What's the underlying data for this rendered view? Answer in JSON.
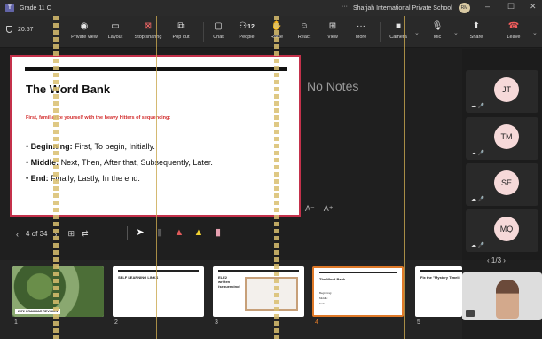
{
  "window": {
    "title": "Grade 11 C",
    "org": "Sharjah International Private School",
    "more": "···",
    "avatar_initials": "RM"
  },
  "toolbar": {
    "timer": "20:57",
    "people_count": "12",
    "buttons": {
      "private_view": "Private view",
      "layout": "Layout",
      "stop_sharing": "Stop sharing",
      "pop_out": "Pop out",
      "chat": "Chat",
      "people": "People",
      "raise": "Raise",
      "react": "React",
      "view": "View",
      "more": "More",
      "camera": "Camera",
      "mic": "Mic",
      "share": "Share",
      "leave": "Leave"
    }
  },
  "slide": {
    "title": "The Word Bank",
    "subtitle": "First, familiarize yourself with the heavy hitters of sequencing:",
    "bullets": [
      {
        "term": "Beginning:",
        "text": " First, To begin, Initially."
      },
      {
        "term": "Middle:",
        "text": " Next, Then, After that, Subsequently, Later."
      },
      {
        "term": "End:",
        "text": " Finally, Lastly, In the end."
      }
    ]
  },
  "notes": {
    "text": "No Notes",
    "font_decrease": "A⁻",
    "font_increase": "A⁺"
  },
  "pager": {
    "current": "4 of 34"
  },
  "participants": {
    "tiles": [
      "JT",
      "TM",
      "SE",
      "MQ"
    ],
    "page": "1/3"
  },
  "filmstrip": {
    "thumbs": [
      {
        "num": "1",
        "caption": "2072 GRAMMAR REVISION"
      },
      {
        "num": "2",
        "title": "SELF LEARNING LINKS"
      },
      {
        "num": "3",
        "title": "ELE2\nwritten\n(sequencing)"
      },
      {
        "num": "4",
        "title": "The Word Bank"
      },
      {
        "num": "5",
        "title": "Fix the \"Mystery Timeli"
      }
    ]
  },
  "colors": {
    "accent": "#c4314b",
    "selection": "#e07a29",
    "leave": "#f25c5c"
  }
}
